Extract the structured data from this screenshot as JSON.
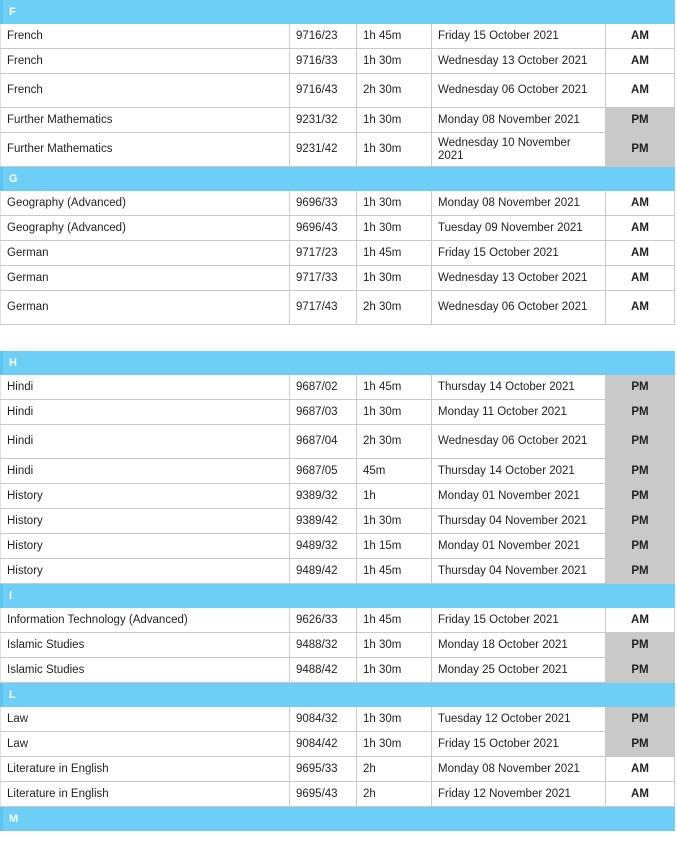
{
  "document": {
    "type": "examination-timetable",
    "colors": {
      "section_header_bg": "#6ECFF6",
      "section_header_accent": "#5CC4EE",
      "session_pm_bg": "#C9C9C9",
      "session_am_bg": "#FFFFFF",
      "row_border": "#C9C9C9",
      "text": "#231F20"
    }
  },
  "sections": [
    {
      "letter": "F",
      "rows": [
        {
          "subject": "French",
          "code": "9716/23",
          "duration": "1h 45m",
          "date": "Friday 15 October 2021",
          "session": "AM",
          "tall": false
        },
        {
          "subject": "French",
          "code": "9716/33",
          "duration": "1h 30m",
          "date": "Wednesday 13 October 2021",
          "session": "AM",
          "tall": false
        },
        {
          "subject": "French",
          "code": "9716/43",
          "duration": "2h 30m",
          "date": "Wednesday 06 October 2021",
          "session": "AM",
          "tall": true
        },
        {
          "subject": "Further Mathematics",
          "code": "9231/32",
          "duration": "1h 30m",
          "date": "Monday 08 November 2021",
          "session": "PM",
          "tall": false
        },
        {
          "subject": "Further Mathematics",
          "code": "9231/42",
          "duration": "1h 30m",
          "date": "Wednesday 10 November 2021",
          "session": "PM",
          "tall": true
        }
      ]
    },
    {
      "letter": "G",
      "rows": [
        {
          "subject": "Geography (Advanced)",
          "code": "9696/33",
          "duration": "1h 30m",
          "date": "Monday 08 November 2021",
          "session": "AM",
          "tall": false
        },
        {
          "subject": "Geography (Advanced)",
          "code": "9696/43",
          "duration": "1h 30m",
          "date": "Tuesday 09 November 2021",
          "session": "AM",
          "tall": false
        },
        {
          "subject": "German",
          "code": "9717/23",
          "duration": "1h 45m",
          "date": "Friday 15 October 2021",
          "session": "AM",
          "tall": false
        },
        {
          "subject": "German",
          "code": "9717/33",
          "duration": "1h 30m",
          "date": "Wednesday 13 October 2021",
          "session": "AM",
          "tall": false
        },
        {
          "subject": "German",
          "code": "9717/43",
          "duration": "2h 30m",
          "date": "Wednesday 06 October 2021",
          "session": "AM",
          "tall": true
        }
      ]
    },
    {
      "letter": "H",
      "page_break_before": true,
      "rows": [
        {
          "subject": "Hindi",
          "code": "9687/02",
          "duration": "1h 45m",
          "date": "Thursday 14 October 2021",
          "session": "PM",
          "tall": false
        },
        {
          "subject": "Hindi",
          "code": "9687/03",
          "duration": "1h 30m",
          "date": "Monday 11 October 2021",
          "session": "PM",
          "tall": false
        },
        {
          "subject": "Hindi",
          "code": "9687/04",
          "duration": "2h 30m",
          "date": "Wednesday 06 October 2021",
          "session": "PM",
          "tall": true
        },
        {
          "subject": "Hindi",
          "code": "9687/05",
          "duration": "45m",
          "date": "Thursday 14 October 2021",
          "session": "PM",
          "tall": false
        },
        {
          "subject": "History",
          "code": "9389/32",
          "duration": "1h",
          "date": "Monday 01 November 2021",
          "session": "PM",
          "tall": false
        },
        {
          "subject": "History",
          "code": "9389/42",
          "duration": "1h 30m",
          "date": "Thursday 04 November 2021",
          "session": "PM",
          "tall": false
        },
        {
          "subject": "History",
          "code": "9489/32",
          "duration": "1h 15m",
          "date": "Monday 01 November 2021",
          "session": "PM",
          "tall": false
        },
        {
          "subject": "History",
          "code": "9489/42",
          "duration": "1h 45m",
          "date": "Thursday 04 November 2021",
          "session": "PM",
          "tall": false
        }
      ]
    },
    {
      "letter": "I",
      "rows": [
        {
          "subject": "Information Technology (Advanced)",
          "code": "9626/33",
          "duration": "1h 45m",
          "date": "Friday 15 October 2021",
          "session": "AM",
          "tall": false
        },
        {
          "subject": "Islamic Studies",
          "code": "9488/32",
          "duration": "1h 30m",
          "date": "Monday 18 October 2021",
          "session": "PM",
          "tall": false
        },
        {
          "subject": "Islamic Studies",
          "code": "9488/42",
          "duration": "1h 30m",
          "date": "Monday 25 October 2021",
          "session": "PM",
          "tall": false
        }
      ]
    },
    {
      "letter": "L",
      "rows": [
        {
          "subject": "Law",
          "code": "9084/32",
          "duration": "1h 30m",
          "date": "Tuesday 12 October 2021",
          "session": "PM",
          "tall": false
        },
        {
          "subject": "Law",
          "code": "9084/42",
          "duration": "1h 30m",
          "date": "Friday 15 October 2021",
          "session": "PM",
          "tall": false
        },
        {
          "subject": "Literature in English",
          "code": "9695/33",
          "duration": "2h",
          "date": "Monday 08 November 2021",
          "session": "AM",
          "tall": false
        },
        {
          "subject": "Literature in English",
          "code": "9695/43",
          "duration": "2h",
          "date": "Friday 12 November 2021",
          "session": "AM",
          "tall": false
        }
      ]
    },
    {
      "letter": "M",
      "rows": []
    }
  ]
}
